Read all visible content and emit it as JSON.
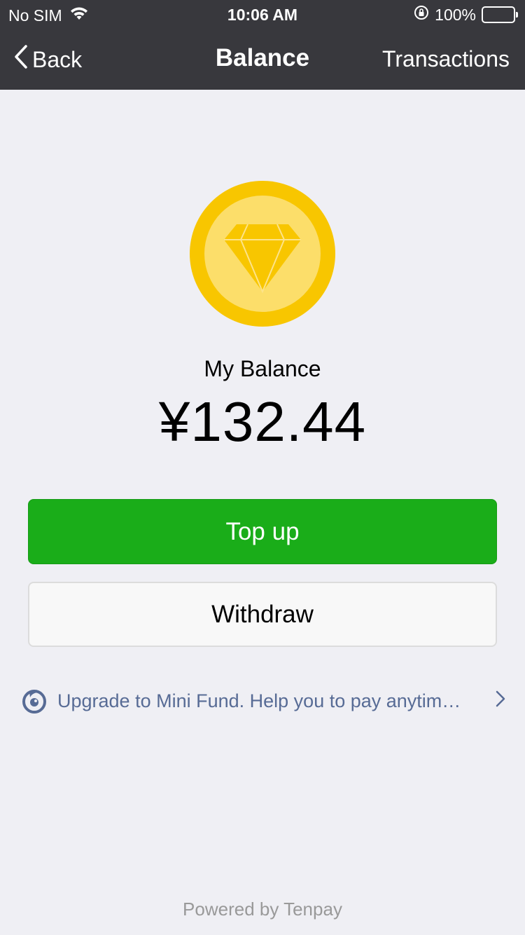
{
  "status_bar": {
    "carrier": "No SIM",
    "time": "10:06 AM",
    "battery": "100%"
  },
  "nav": {
    "back_label": "Back",
    "title": "Balance",
    "right_label": "Transactions"
  },
  "balance": {
    "label": "My Balance",
    "amount": "¥132.44"
  },
  "buttons": {
    "top_up": "Top up",
    "withdraw": "Withdraw"
  },
  "promo": {
    "text": "Upgrade to Mini Fund. Help you to pay anytim…"
  },
  "footer": "Powered by Tenpay",
  "colors": {
    "nav_bg": "#38383d",
    "primary_green": "#1aad19",
    "coin_outer": "#f8c600",
    "coin_inner": "#fcde6a",
    "link_blue": "#576b95"
  }
}
